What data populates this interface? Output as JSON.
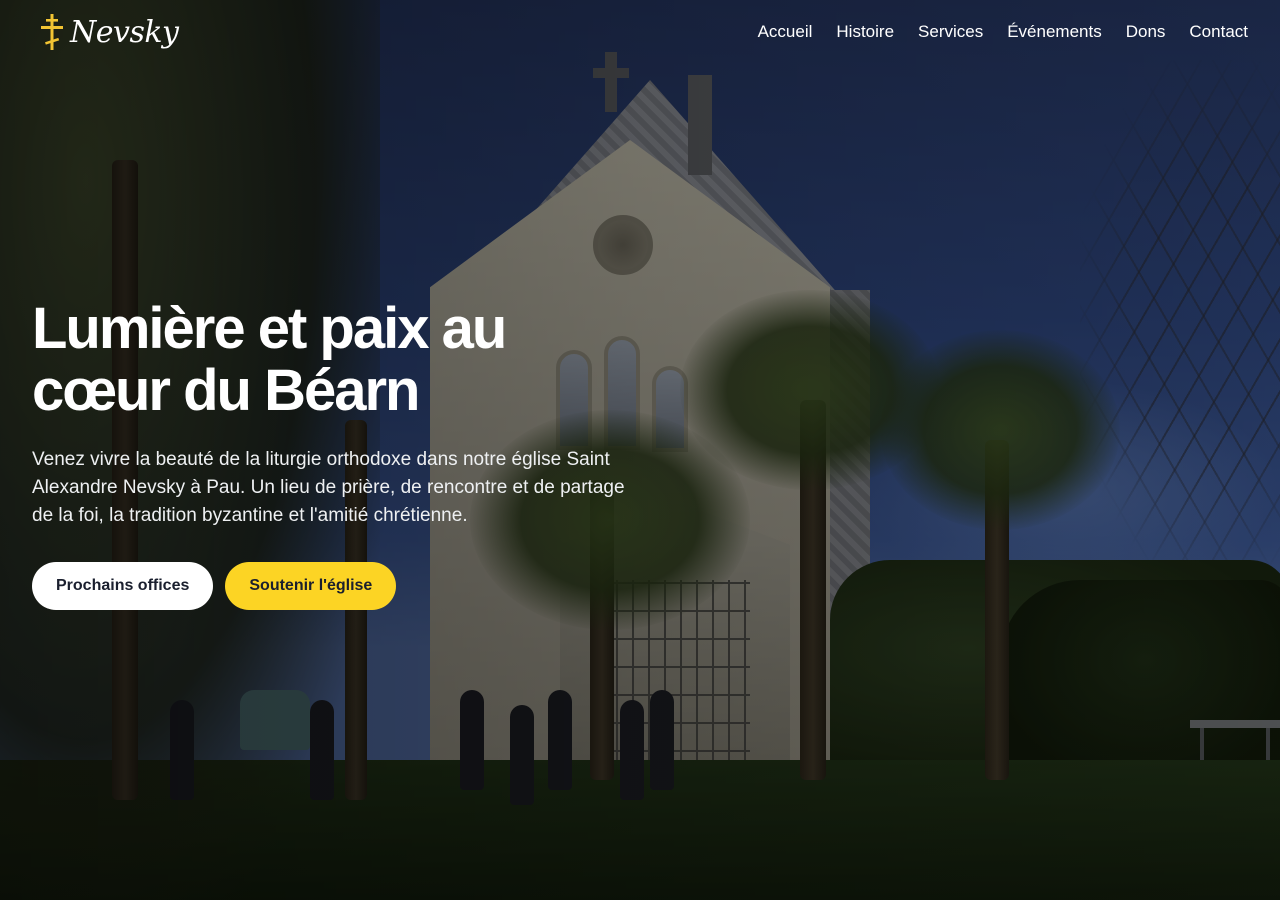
{
  "brand": {
    "name": "Nevsky",
    "logo_icon": "orthodox-cross-icon",
    "logo_color": "#f2c433"
  },
  "nav": {
    "items": [
      {
        "label": "Accueil"
      },
      {
        "label": "Histoire"
      },
      {
        "label": "Services"
      },
      {
        "label": "Événements"
      },
      {
        "label": "Dons"
      },
      {
        "label": "Contact"
      }
    ]
  },
  "hero": {
    "title_line1": "Lumière et paix au",
    "title_line2": "cœur du Béarn",
    "lead": "Venez vivre la beauté de la liturgie orthodoxe dans notre église Saint Alexandre Nevsky à Pau. Un lieu de prière, de rencontre et de partage de la foi, la tradition byzantine et l'amitié chrétienne.",
    "primary_button": "Prochains offices",
    "secondary_button": "Soutenir l'église"
  },
  "colors": {
    "accent": "#fcd424",
    "button_light": "#ffffff",
    "button_text": "#1a1f2e"
  }
}
